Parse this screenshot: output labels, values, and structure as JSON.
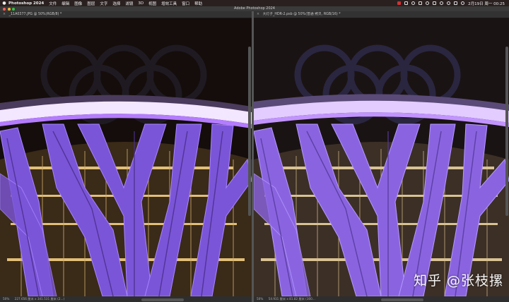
{
  "menubar": {
    "apple_icon": "apple-icon",
    "app_name": "Photoshop 2024",
    "items": [
      "文件",
      "编辑",
      "图像",
      "图层",
      "文字",
      "选择",
      "滤镜",
      "3D",
      "视图",
      "增效工具",
      "窗口",
      "帮助"
    ],
    "clock": "2月19日 周一 00:25"
  },
  "window": {
    "title": "Adobe Photoshop 2024",
    "traffic_colors": [
      "#ff5f57",
      "#febc2e",
      "#28c840"
    ]
  },
  "left_doc": {
    "tab_title": "_11A0377.JPG @ 50%(RGB/8) *",
    "zoom": "50%",
    "status": "227.656 厘米 x 341.531 厘米 (2...)"
  },
  "right_doc": {
    "tab_title": "大灯子_HDR-2.psb @ 50%(普通 拷贝, RGB/16) *",
    "zoom": "50%",
    "status": "54.931 厘米 x 81.82 厘米 (300..."
  },
  "watermark": "知乎 @张枝摞",
  "colors": {
    "accent_purple": "#8a5cf0",
    "warm_light": "#ffd98a"
  }
}
